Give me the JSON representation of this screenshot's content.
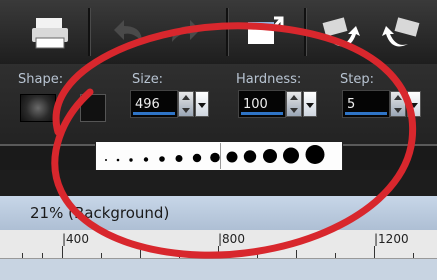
{
  "toolbar": {
    "icons": [
      "print-icon",
      "undo-icon",
      "redo-icon",
      "export-icon",
      "rotate-left-icon",
      "rotate-right-icon"
    ]
  },
  "options": {
    "shape_label": "Shape:",
    "size_label": "Size:",
    "size_value": "496",
    "hardness_label": "Hardness:",
    "hardness_value": "100",
    "step_label": "Step:",
    "step_value": "5"
  },
  "document": {
    "title": "21% (Background)",
    "ruler_labels": [
      "|400",
      "|800",
      "|1200"
    ]
  },
  "colors": {
    "annotation": "#d8272d",
    "accent": "#2f74c6"
  }
}
